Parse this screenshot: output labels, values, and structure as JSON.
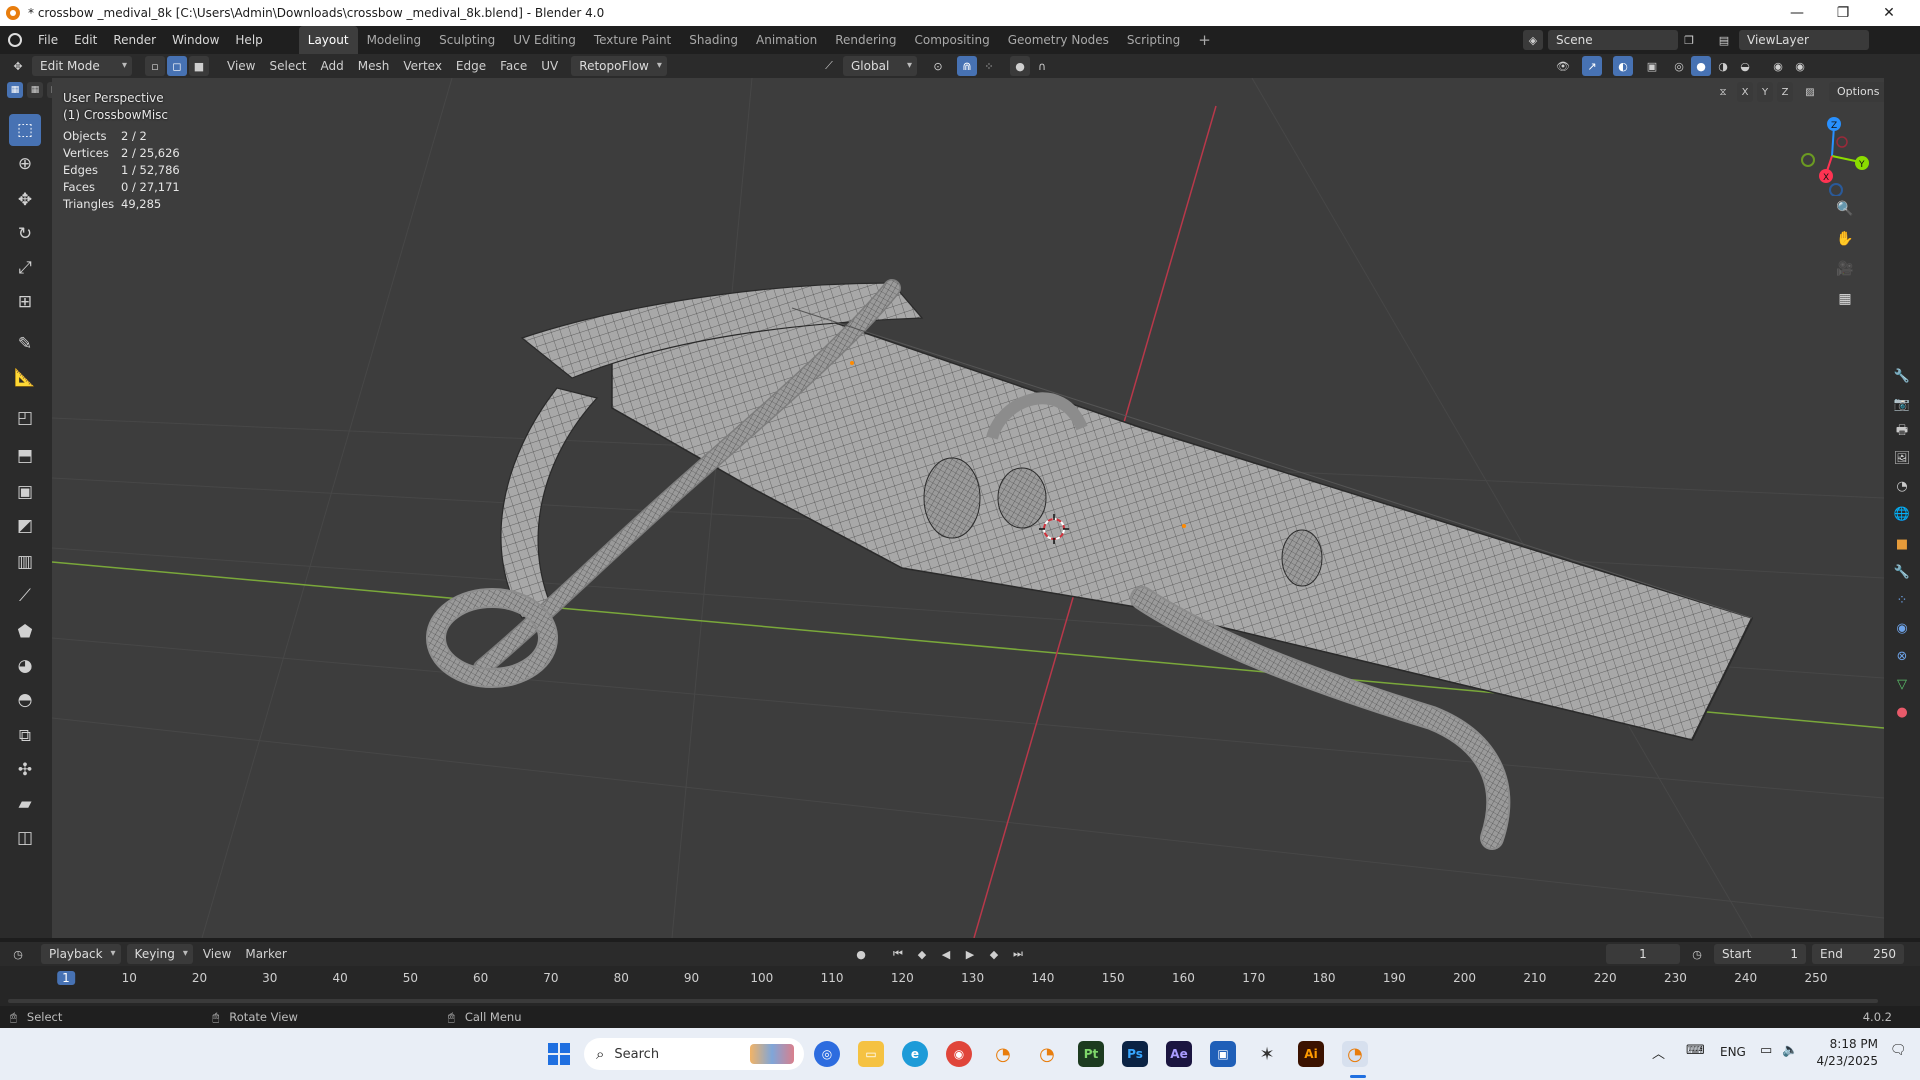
{
  "window": {
    "title": "* crossbow _medival_8k [C:\\Users\\Admin\\Downloads\\crossbow _medival_8k.blend] - Blender 4.0"
  },
  "menu": [
    "File",
    "Edit",
    "Render",
    "Window",
    "Help"
  ],
  "workspaces": [
    "Layout",
    "Modeling",
    "Sculpting",
    "UV Editing",
    "Texture Paint",
    "Shading",
    "Animation",
    "Rendering",
    "Compositing",
    "Geometry Nodes",
    "Scripting"
  ],
  "active_workspace": "Layout",
  "scene": {
    "name": "Scene",
    "view_layer": "ViewLayer"
  },
  "header": {
    "mode": "Edit Mode",
    "menus": [
      "View",
      "Select",
      "Add",
      "Mesh",
      "Vertex",
      "Edge",
      "Face",
      "UV"
    ],
    "addon": "RetopoFlow",
    "orientation": "Global",
    "axes": [
      "X",
      "Y",
      "Z"
    ],
    "options": "Options"
  },
  "viewport": {
    "perspective": "User Perspective",
    "object": "(1) CrossbowMisc",
    "stats": [
      {
        "label": "Objects",
        "value": "2 / 2"
      },
      {
        "label": "Vertices",
        "value": "2 / 25,626"
      },
      {
        "label": "Edges",
        "value": "1 / 52,786"
      },
      {
        "label": "Faces",
        "value": "0 / 27,171"
      },
      {
        "label": "Triangles",
        "value": "49,285"
      }
    ],
    "gizmo": {
      "z": "Z",
      "y": "Y",
      "x": "X"
    }
  },
  "timeline": {
    "menus": [
      "Playback",
      "Keying",
      "View",
      "Marker"
    ],
    "current_frame": "1",
    "start_label": "Start",
    "start": "1",
    "end_label": "End",
    "end": "250",
    "ticks": [
      "1",
      "10",
      "20",
      "30",
      "40",
      "50",
      "60",
      "70",
      "80",
      "90",
      "100",
      "110",
      "120",
      "130",
      "140",
      "150",
      "160",
      "170",
      "180",
      "190",
      "200",
      "210",
      "220",
      "230",
      "240",
      "250"
    ]
  },
  "statusbar": {
    "select": "Select",
    "rotate": "Rotate View",
    "menu": "Call Menu",
    "version": "4.0.2"
  },
  "taskbar": {
    "search_placeholder": "Search",
    "lang": "ENG",
    "time": "8:18 PM",
    "date": "4/23/2025"
  },
  "colors": {
    "accent": "#4772b3",
    "x_axis": "#ff3352",
    "y_axis": "#8bdc00",
    "z_axis": "#2890ff",
    "viewport_bg": "#3d3d3d"
  }
}
